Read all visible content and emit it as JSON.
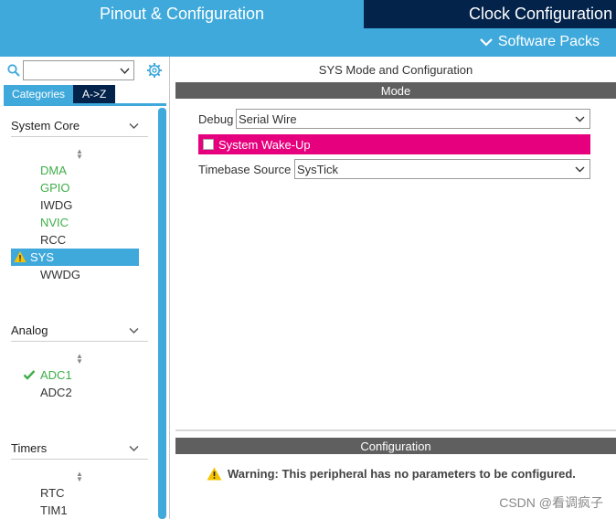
{
  "header": {
    "tab_pinout": "Pinout & Configuration",
    "tab_clock": "Clock Configuration",
    "software_packs": "Software Packs"
  },
  "sidebar": {
    "search_value": "",
    "tabs": [
      "Categories",
      "A->Z"
    ],
    "groups": [
      {
        "title": "System Core",
        "items": [
          {
            "label": "DMA",
            "state": "configured"
          },
          {
            "label": "GPIO",
            "state": "configured"
          },
          {
            "label": "IWDG",
            "state": "normal"
          },
          {
            "label": "NVIC",
            "state": "configured"
          },
          {
            "label": "RCC",
            "state": "normal"
          },
          {
            "label": "SYS",
            "state": "warning-selected"
          },
          {
            "label": "WWDG",
            "state": "normal"
          }
        ]
      },
      {
        "title": "Analog",
        "items": [
          {
            "label": "ADC1",
            "state": "ok"
          },
          {
            "label": "ADC2",
            "state": "normal"
          }
        ]
      },
      {
        "title": "Timers",
        "items": [
          {
            "label": "RTC",
            "state": "normal"
          },
          {
            "label": "TIM1",
            "state": "normal"
          }
        ]
      }
    ]
  },
  "main": {
    "title": "SYS Mode and Configuration",
    "mode_bar": "Mode",
    "debug_label": "Debug",
    "debug_value": "Serial Wire",
    "wakeup_label": "System Wake-Up",
    "timebase_label": "Timebase Source",
    "timebase_value": "SysTick",
    "config_bar": "Configuration",
    "warning": "Warning: This peripheral has no parameters to be configured."
  },
  "watermark": "CSDN @看调疯子",
  "colors": {
    "accent": "#3fa9dc",
    "dark_navy": "#03234b",
    "magenta": "#e6007e",
    "configured_green": "#3fae49",
    "bar_gray": "#5f5f5f"
  }
}
